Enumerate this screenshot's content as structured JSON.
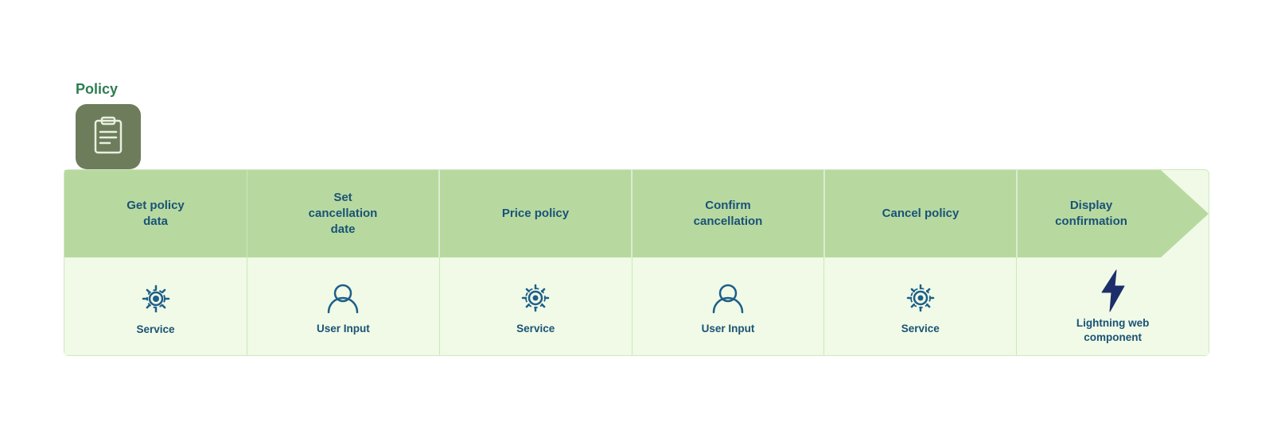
{
  "policy": {
    "label": "Policy",
    "icon": "policy-icon"
  },
  "steps": [
    {
      "id": "get-policy-data",
      "label": "Get policy\ndata",
      "icon_type": "service",
      "icon_label": "Service"
    },
    {
      "id": "set-cancellation-date",
      "label": "Set\ncancellation\ndate",
      "icon_type": "user-input",
      "icon_label": "User Input"
    },
    {
      "id": "price-policy",
      "label": "Price policy",
      "icon_type": "service",
      "icon_label": "Service"
    },
    {
      "id": "confirm-cancellation",
      "label": "Confirm\ncancellation",
      "icon_type": "user-input",
      "icon_label": "User Input"
    },
    {
      "id": "cancel-policy",
      "label": "Cancel policy",
      "icon_type": "service",
      "icon_label": "Service"
    },
    {
      "id": "display-confirmation",
      "label": "Display\nconfirmation",
      "icon_type": "lightning",
      "icon_label": "Lightning web\ncomponent"
    }
  ],
  "colors": {
    "banner_green": "#b7d9a0",
    "bg_light": "#f0fae6",
    "text_blue": "#1a5276",
    "icon_blue": "#1d5f8a",
    "border": "#d0e8c0",
    "policy_icon_bg": "#6d7c5a"
  }
}
